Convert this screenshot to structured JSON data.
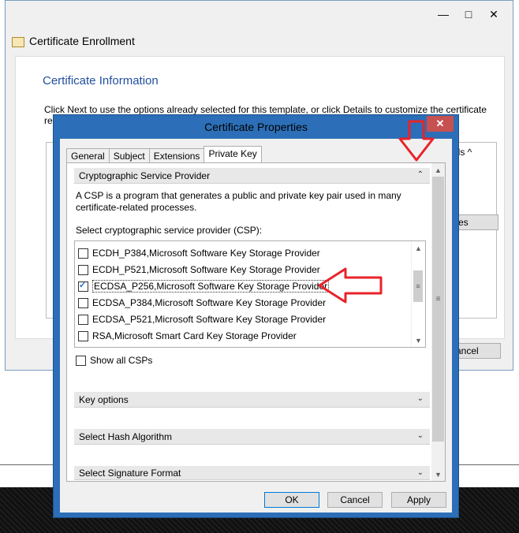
{
  "background_window": {
    "title": "Certificate Enrollment",
    "controls": {
      "minimize": "—",
      "maximize": "□",
      "close": "✕"
    },
    "section_title": "Certificate Information",
    "instruction_line1": "Click Next to use the options already selected for this template, or click Details to customize the certificate",
    "instruction_line2": "re",
    "details_fragment": "ils ^",
    "properties_fragment": "es",
    "cancel_fragment": "ancel"
  },
  "dialog": {
    "title": "Certificate Properties",
    "close_label": "✕",
    "tabs": [
      {
        "label": "General",
        "active": false
      },
      {
        "label": "Subject",
        "active": false
      },
      {
        "label": "Extensions",
        "active": false
      },
      {
        "label": "Private Key",
        "active": true
      }
    ],
    "csp_section": {
      "header": "Cryptographic Service Provider",
      "description": "A CSP is a program that generates a public and private key pair used in many certificate-related processes.",
      "select_label": "Select cryptographic service provider (CSP):",
      "providers": [
        {
          "label": "ECDH_P384,Microsoft Software Key Storage Provider",
          "checked": false
        },
        {
          "label": "ECDH_P521,Microsoft Software Key Storage Provider",
          "checked": false
        },
        {
          "label": "ECDSA_P256,Microsoft Software Key Storage Provider",
          "checked": true
        },
        {
          "label": "ECDSA_P384,Microsoft Software Key Storage Provider",
          "checked": false
        },
        {
          "label": "ECDSA_P521,Microsoft Software Key Storage Provider",
          "checked": false
        },
        {
          "label": "RSA,Microsoft Smart Card Key Storage Provider",
          "checked": false
        }
      ],
      "show_all_label": "Show all CSPs",
      "show_all_checked": false
    },
    "collapsed_sections": [
      {
        "label": "Key options"
      },
      {
        "label": "Select Hash Algorithm"
      },
      {
        "label": "Select Signature Format"
      }
    ],
    "buttons": {
      "ok": "OK",
      "cancel": "Cancel",
      "apply": "Apply"
    }
  },
  "icons": {
    "chevron_up": "⌃",
    "chevron_down": "⌄",
    "scroll_up": "▲",
    "scroll_down": "▼",
    "grip": "≡"
  },
  "colors": {
    "dialog_frame": "#2c6fb8",
    "close_button": "#c75050",
    "annotation_arrow": "#e8232a",
    "info_title": "#1f4e9d"
  }
}
